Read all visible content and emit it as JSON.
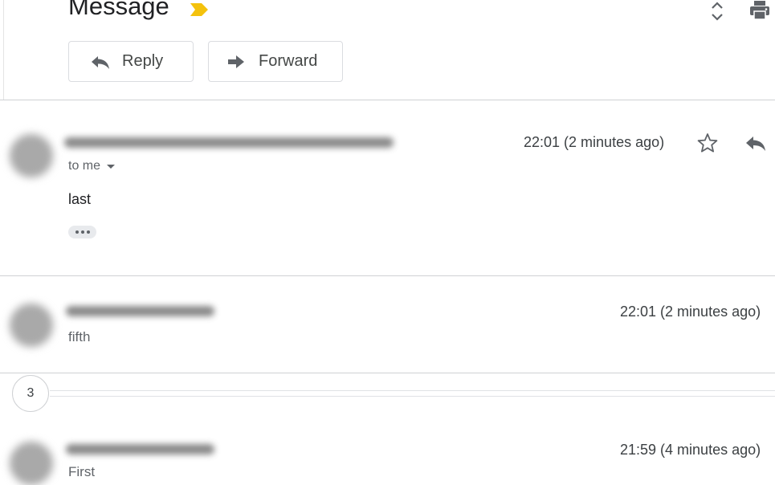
{
  "header": {
    "title": "Message",
    "label_color": "#f4c20d"
  },
  "actions": {
    "reply_label": "Reply",
    "forward_label": "Forward"
  },
  "messages": [
    {
      "state": "expanded",
      "time": "22:01 (2 minutes ago)",
      "recipient": "to me",
      "body": "last"
    },
    {
      "state": "collapsed",
      "time": "22:01 (2 minutes ago)",
      "snippet": "fifth"
    },
    {
      "state": "collapsed",
      "time": "21:59 (4 minutes ago)",
      "snippet": "First"
    }
  ],
  "hidden_messages": {
    "count": "3"
  },
  "icons": {
    "label": "label-marker-icon",
    "expand": "expand-all-icon",
    "print": "print-icon",
    "reply": "reply-icon",
    "forward": "forward-icon",
    "star": "star-icon",
    "more": "more-dots-icon"
  }
}
